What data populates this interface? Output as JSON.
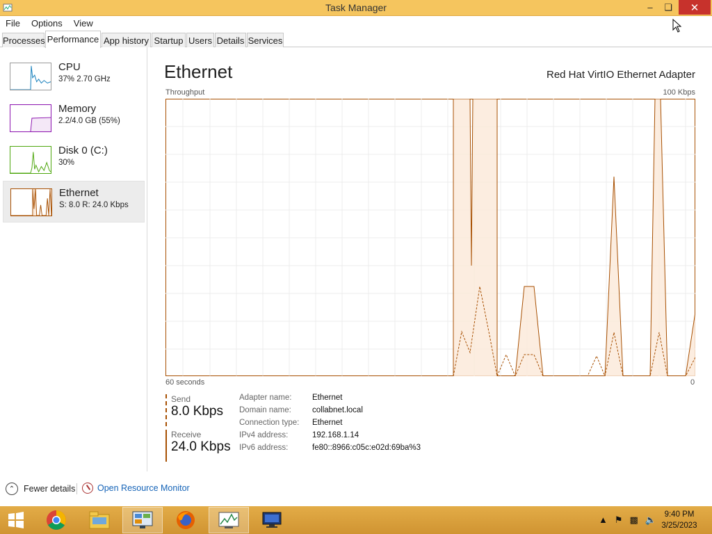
{
  "window": {
    "title": "Task Manager"
  },
  "menu": [
    "File",
    "Options",
    "View"
  ],
  "tabs": [
    "Processes",
    "Performance",
    "App history",
    "Startup",
    "Users",
    "Details",
    "Services"
  ],
  "sidebar": {
    "items": [
      {
        "title": "CPU",
        "subtitle": "37%  2.70 GHz"
      },
      {
        "title": "Memory",
        "subtitle": "2.2/4.0 GB (55%)"
      },
      {
        "title": "Disk 0 (C:)",
        "subtitle": "30%"
      },
      {
        "title": "Ethernet",
        "subtitle": "S: 8.0  R: 24.0 Kbps"
      }
    ]
  },
  "main": {
    "title": "Ethernet",
    "adapter_desc": "Red Hat VirtIO Ethernet Adapter",
    "graph_label": "Throughput",
    "graph_max": "100 Kbps",
    "graph_left": "60 seconds",
    "graph_right": "0"
  },
  "stats": {
    "send_label": "Send",
    "send_value": "8.0 Kbps",
    "receive_label": "Receive",
    "receive_value": "24.0 Kbps"
  },
  "properties": [
    {
      "key": "Adapter name:",
      "value": "Ethernet"
    },
    {
      "key": "Domain name:",
      "value": "collabnet.local"
    },
    {
      "key": "Connection type:",
      "value": "Ethernet"
    },
    {
      "key": "IPv4 address:",
      "value": "192.168.1.14"
    },
    {
      "key": "IPv6 address:",
      "value": "fe80::8966:c05c:e02d:69ba%3"
    }
  ],
  "footer": {
    "fewer_details": "Fewer details",
    "open_resource_monitor": "Open Resource Monitor"
  },
  "taskbar": {
    "apps": [
      "start-icon",
      "chrome-icon",
      "file-explorer-icon",
      "control-panel-icon",
      "firefox-icon",
      "task-manager-icon",
      "remote-desktop-icon"
    ],
    "time": "9:40 PM",
    "date": "3/25/2023"
  },
  "colors": {
    "ethernet": "#a74f01",
    "cpu": "#117dbb",
    "memory": "#8b12ae",
    "disk": "#4da60c",
    "titlebar": "#f5c55e",
    "taskbar": "#d9a03a"
  }
}
